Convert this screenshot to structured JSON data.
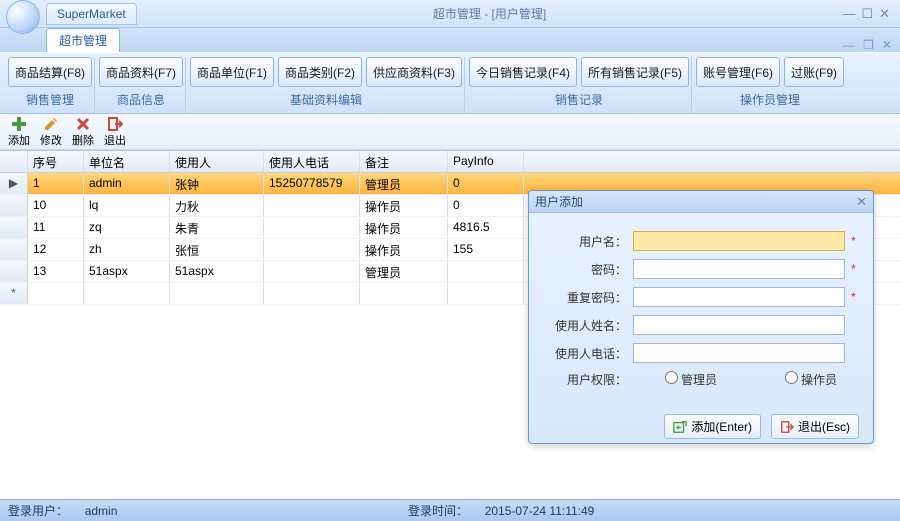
{
  "window": {
    "app_name": "SuperMarket",
    "title": "超市管理 - [用户管理]",
    "tab": "超市管理"
  },
  "ribbon": {
    "groups": [
      {
        "label": "销售管理",
        "buttons": [
          "商品结算(F8)"
        ]
      },
      {
        "label": "商品信息",
        "buttons": [
          "商品资料(F7)"
        ]
      },
      {
        "label": "基础资料编辑",
        "buttons": [
          "商品单位(F1)",
          "商品类别(F2)",
          "供应商资料(F3)"
        ]
      },
      {
        "label": "销售记录",
        "buttons": [
          "今日销售记录(F4)",
          "所有销售记录(F5)"
        ]
      },
      {
        "label": "操作员管理",
        "buttons": [
          "账号管理(F6)",
          "过账(F9)"
        ]
      }
    ]
  },
  "toolbar": {
    "items": [
      "添加",
      "修改",
      "删除",
      "退出"
    ]
  },
  "grid": {
    "columns": [
      "",
      "序号",
      "单位名",
      "使用人",
      "使用人电话",
      "备注",
      "PayInfo"
    ],
    "rows": [
      {
        "sel": true,
        "cells": [
          "▶",
          "1",
          "admin",
          "张钟",
          "15250778579",
          "管理员",
          "0"
        ]
      },
      {
        "sel": false,
        "cells": [
          "",
          "10",
          "lq",
          "力秋",
          "",
          "操作员",
          "0"
        ]
      },
      {
        "sel": false,
        "cells": [
          "",
          "11",
          "zq",
          "朱青",
          "",
          "操作员",
          "4816.5"
        ]
      },
      {
        "sel": false,
        "cells": [
          "",
          "12",
          "zh",
          "张恒",
          "",
          "操作员",
          "155"
        ]
      },
      {
        "sel": false,
        "cells": [
          "",
          "13",
          "51aspx",
          "51aspx",
          "",
          "管理员",
          ""
        ]
      }
    ]
  },
  "dialog": {
    "title": "用户添加",
    "fields": {
      "username": "用户名：",
      "password": "密码：",
      "repeat": "重复密码：",
      "realname": "使用人姓名：",
      "phone": "使用人电话：",
      "role": "用户权限："
    },
    "roles": {
      "admin": "管理员",
      "operator": "操作员"
    },
    "buttons": {
      "add": "添加(Enter)",
      "exit": "退出(Esc)"
    }
  },
  "status": {
    "user_label": "登录用户：",
    "user": "admin",
    "time_label": "登录时间：",
    "time": "2015-07-24 11:11:49"
  }
}
